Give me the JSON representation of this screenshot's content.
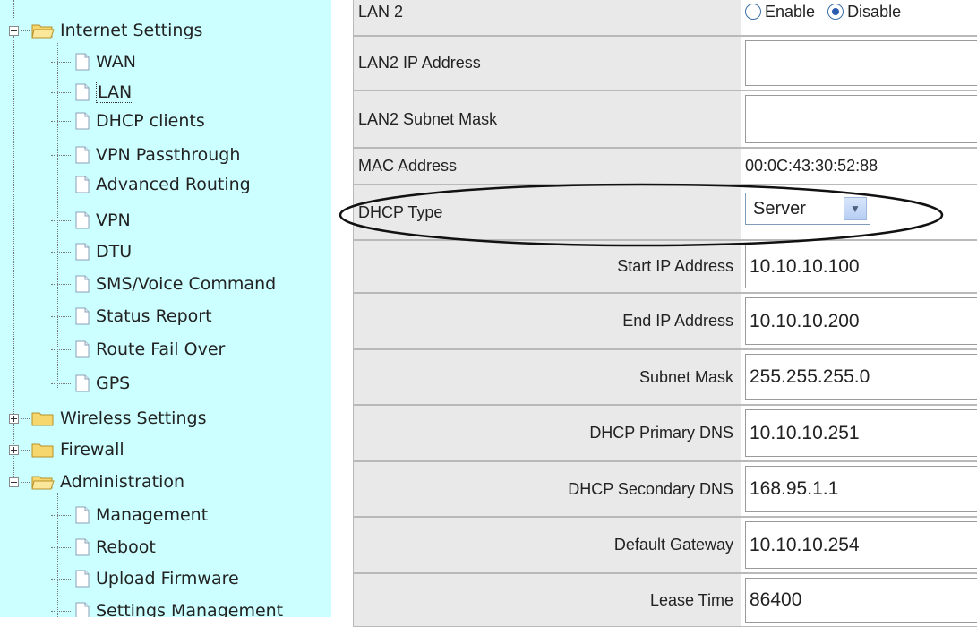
{
  "tree": {
    "internet_settings": "Internet Settings",
    "internet_items": [
      "WAN",
      "LAN",
      "DHCP clients",
      "VPN Passthrough",
      "Advanced Routing",
      "VPN",
      "DTU",
      "SMS/Voice Command",
      "Status Report",
      "Route Fail Over",
      "GPS"
    ],
    "selected_item": "LAN",
    "wireless_settings": "Wireless Settings",
    "firewall": "Firewall",
    "administration": "Administration",
    "admin_items": [
      "Management",
      "Reboot",
      "Upload Firmware",
      "Settings Management"
    ]
  },
  "form": {
    "lan2_label": "LAN 2",
    "lan2_enable": "Enable",
    "lan2_disable": "Disable",
    "lan2_selected": "Disable",
    "lan2_ip_label": "LAN2 IP Address",
    "lan2_ip_value": "",
    "lan2_mask_label": "LAN2 Subnet Mask",
    "lan2_mask_value": "",
    "mac_label": "MAC Address",
    "mac_value": "00:0C:43:30:52:88",
    "dhcp_type_label": "DHCP Type",
    "dhcp_type_value": "Server",
    "start_ip_label": "Start IP Address",
    "start_ip_value": "10.10.10.100",
    "end_ip_label": "End IP Address",
    "end_ip_value": "10.10.10.200",
    "subnet_label": "Subnet Mask",
    "subnet_value": "255.255.255.0",
    "primary_dns_label": "DHCP Primary DNS",
    "primary_dns_value": "10.10.10.251",
    "secondary_dns_label": "DHCP Secondary DNS",
    "secondary_dns_value": "168.95.1.1",
    "gateway_label": "Default Gateway",
    "gateway_value": "10.10.10.254",
    "lease_label": "Lease Time",
    "lease_value": "86400"
  },
  "colors": {
    "tree_bg": "#ccffff",
    "label_bg": "#e9e9e9",
    "folder": "#f5d76e"
  }
}
